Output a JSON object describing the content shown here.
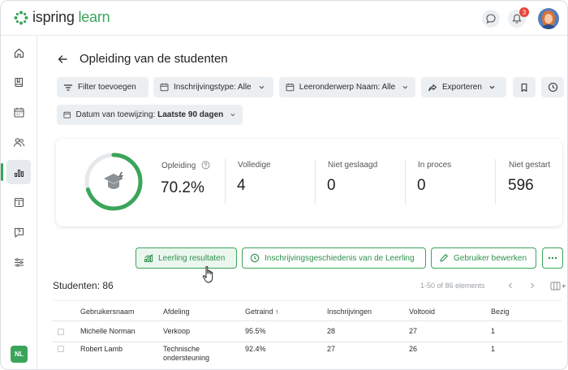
{
  "app": {
    "logo_text_main": "ispring",
    "logo_text_accent": "learn",
    "notifications_count": "3",
    "brand_color": "#3aa55a"
  },
  "sidebar": {
    "items": [
      {
        "icon": "home-icon"
      },
      {
        "icon": "book-icon"
      },
      {
        "icon": "calendar-icon"
      },
      {
        "icon": "users-icon"
      },
      {
        "icon": "reports-icon",
        "active": true
      },
      {
        "icon": "info-icon"
      },
      {
        "icon": "help-icon"
      },
      {
        "icon": "settings-sliders-icon"
      }
    ],
    "lang": "NL"
  },
  "page": {
    "title": "Opleiding van de studenten"
  },
  "filters": {
    "add_filter": "Filter toevoegen",
    "enrollment_type": "Inschrijvingstype: Alle",
    "subject": "Leeronderwerp Naam: Alle",
    "export": "Exporteren",
    "date_label": "Datum van toewijzing:",
    "date_value": "Laatste 90 dagen"
  },
  "stats": {
    "progress_fraction": 0.702,
    "items": [
      {
        "label": "Opleiding",
        "value": "70.2%"
      },
      {
        "label": "Volledige",
        "value": "4"
      },
      {
        "label": "Niet geslaagd",
        "value": "0"
      },
      {
        "label": "In proces",
        "value": "0"
      },
      {
        "label": "Niet gestart",
        "value": "596"
      }
    ]
  },
  "actions": {
    "results": "Leerling resultaten",
    "history": "Inschrijvingsgeschiedenis van de Leerling",
    "edit": "Gebruiker bewerken"
  },
  "table": {
    "count_label": "Studenten: 86",
    "pager": "1-50 of 86 elements",
    "columns": [
      "Gebruikersnaam",
      "Afdeling",
      "Getraind ↑",
      "Inschrijvingen",
      "Voltooid",
      "Bezig"
    ],
    "rows": [
      {
        "name": "Michelle Norman",
        "dept": "Verkoop",
        "dept2": "",
        "trained": "95.5%",
        "enrollments": "28",
        "completed": "27",
        "in_progress": "1"
      },
      {
        "name": "Robert Lamb",
        "dept": "Technische",
        "dept2": "ondersteuning",
        "trained": "92.4%",
        "enrollments": "27",
        "completed": "26",
        "in_progress": "1"
      }
    ]
  }
}
